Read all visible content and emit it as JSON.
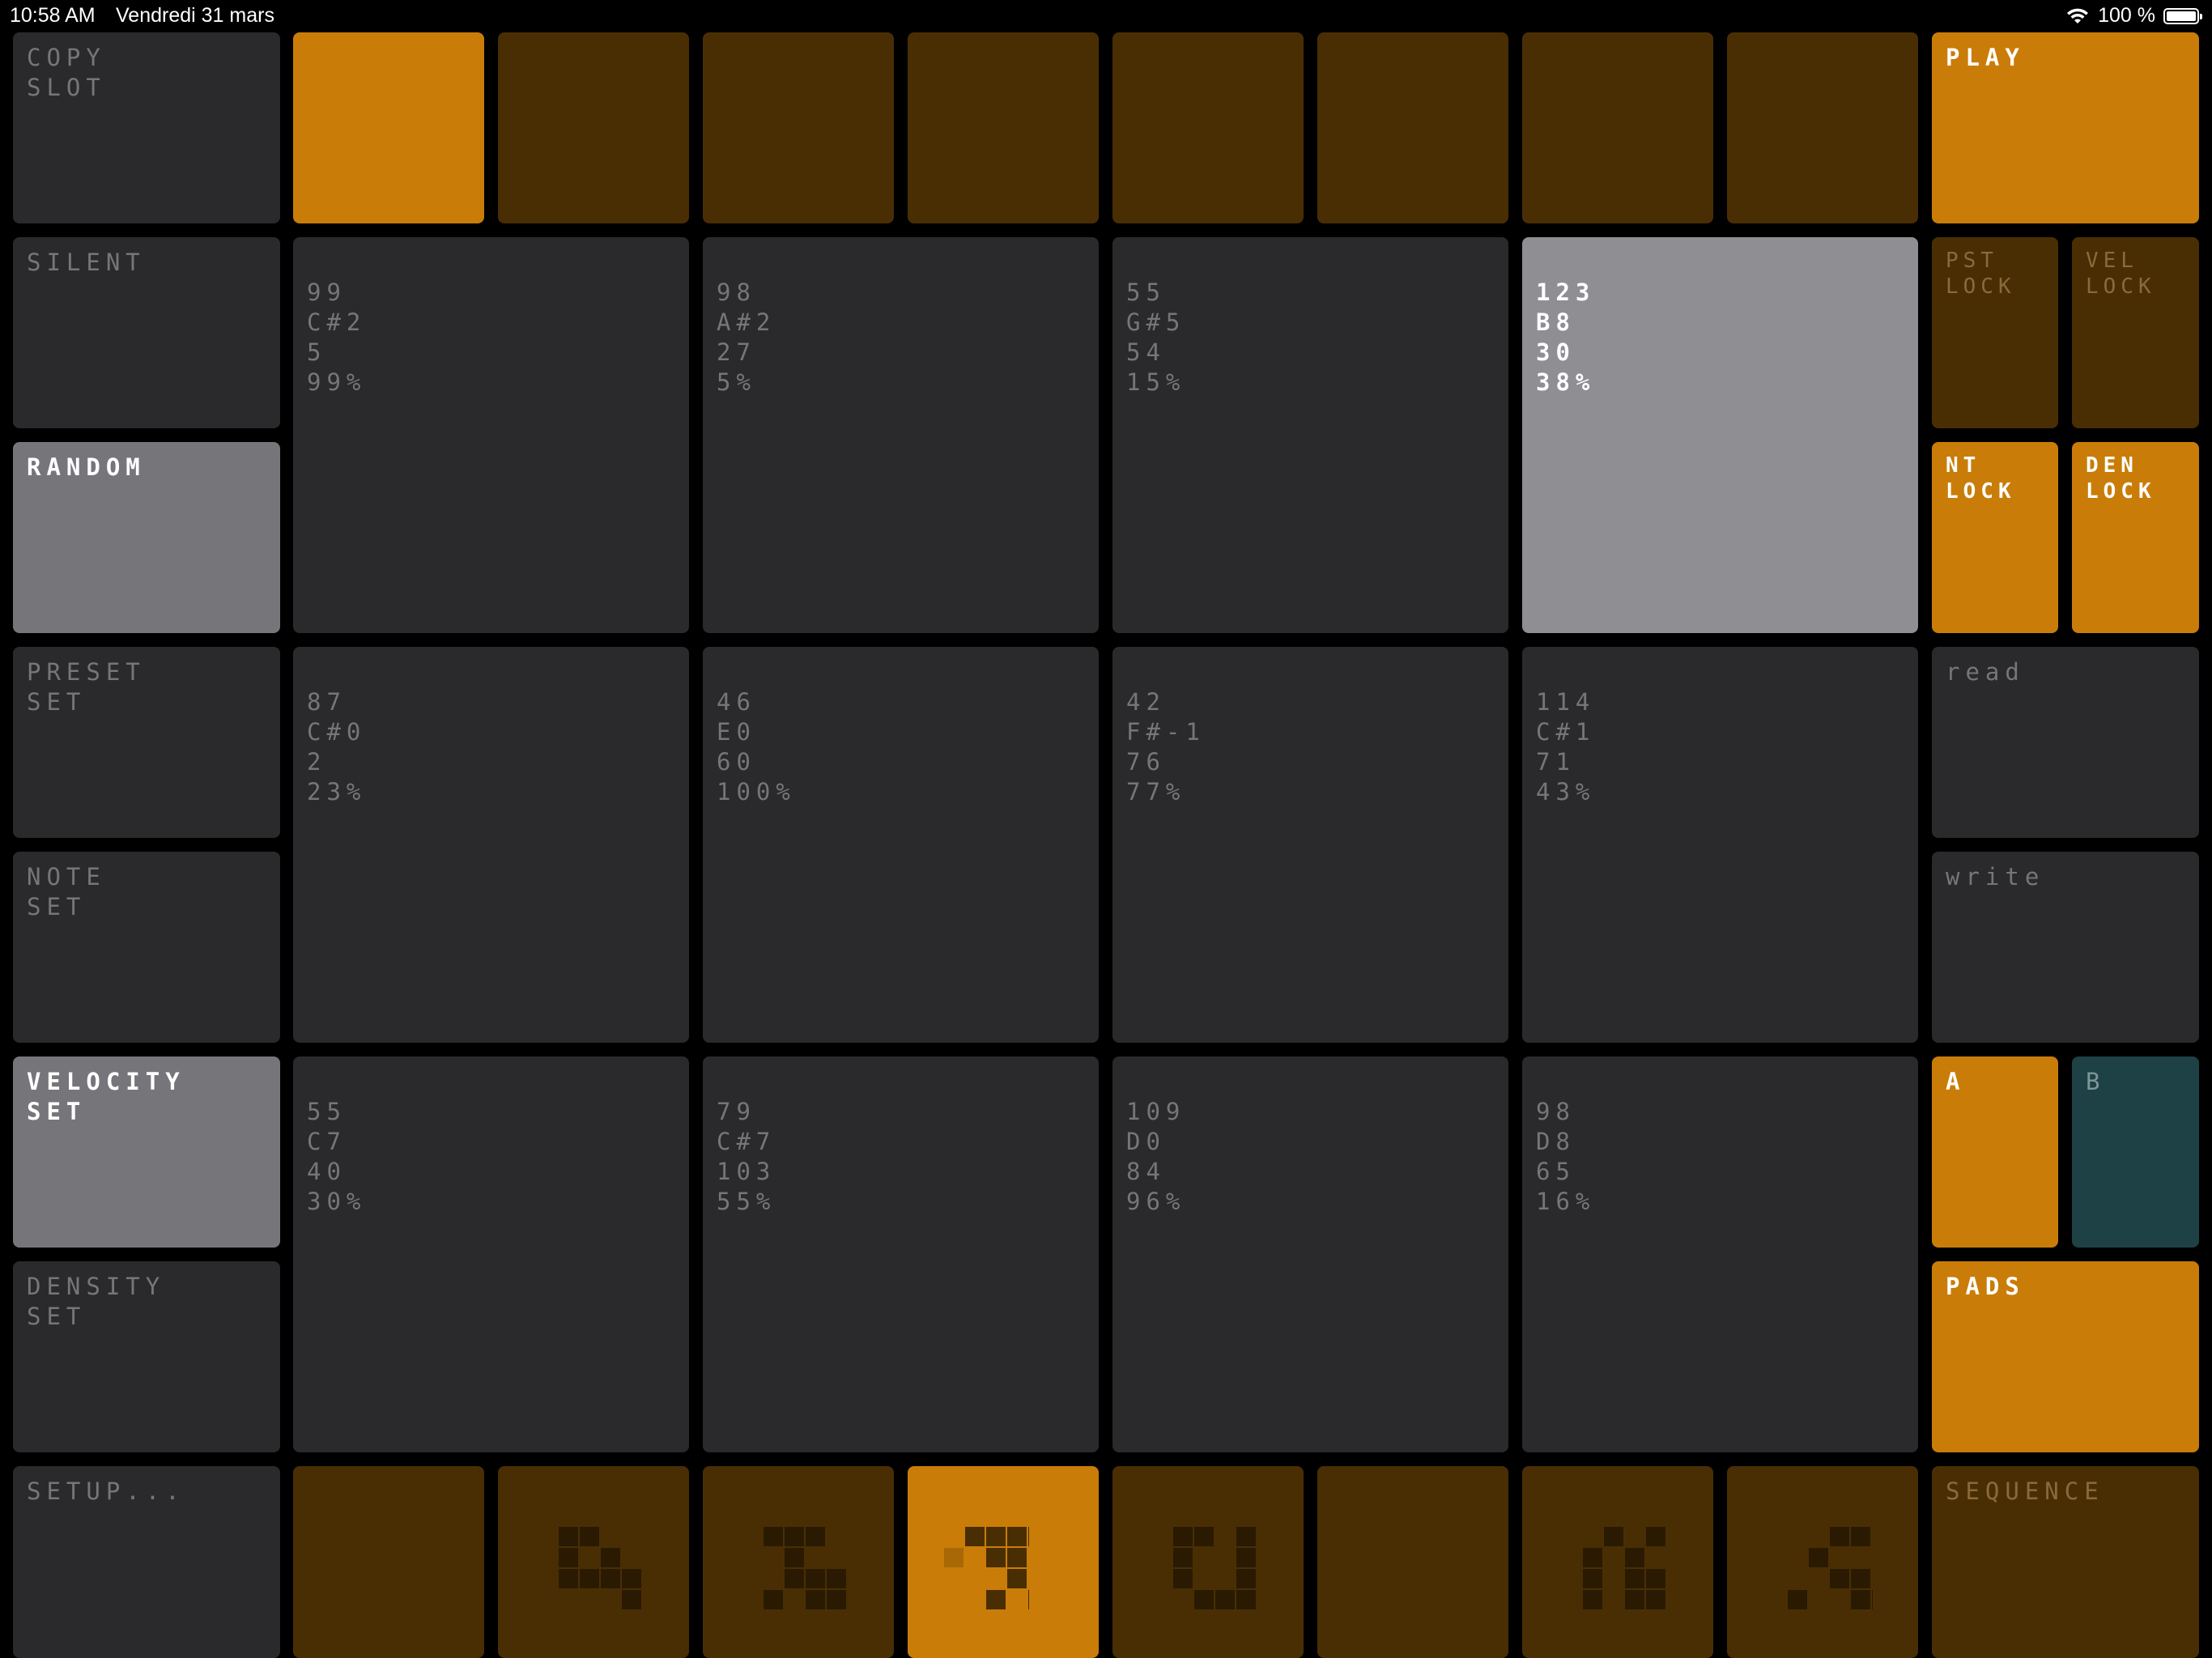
{
  "status": {
    "time": "10:58 AM",
    "date": "Vendredi 31 mars",
    "battery": "100 %"
  },
  "left": {
    "copy_slot": "COPY\nSLOT",
    "silent": "SILENT",
    "random": "RANDOM",
    "preset_set": "PRESET\nSET",
    "note_set": "NOTE\nSET",
    "velocity_set": "VELOCITY\nSET",
    "density_set": "DENSITY\nSET",
    "setup": "SETUP..."
  },
  "right": {
    "play": "PLAY",
    "pst_lock": "PST\nLOCK",
    "vel_lock": "VEL\nLOCK",
    "nt_lock": "NT\nLOCK",
    "den_lock": "DEN\nLOCK",
    "read": "read",
    "write": "write",
    "a": "A",
    "b": "B",
    "pads": "PADS",
    "sequence": "SEQUENCE"
  },
  "pads": [
    {
      "preset": "99",
      "note": "C#2",
      "velocity": "5",
      "density": "99%"
    },
    {
      "preset": "98",
      "note": "A#2",
      "velocity": "27",
      "density": "5%"
    },
    {
      "preset": "55",
      "note": "G#5",
      "velocity": "54",
      "density": "15%"
    },
    {
      "preset": "123",
      "note": "B8",
      "velocity": "30",
      "density": "38%"
    },
    {
      "preset": "87",
      "note": "C#0",
      "velocity": "2",
      "density": "23%"
    },
    {
      "preset": "46",
      "note": "E0",
      "velocity": "60",
      "density": "100%"
    },
    {
      "preset": "42",
      "note": "F#-1",
      "velocity": "76",
      "density": "77%"
    },
    {
      "preset": "114",
      "note": "C#1",
      "velocity": "71",
      "density": "43%"
    },
    {
      "preset": "55",
      "note": "C7",
      "velocity": "40",
      "density": "30%"
    },
    {
      "preset": "79",
      "note": "C#7",
      "velocity": "103",
      "density": "55%"
    },
    {
      "preset": "109",
      "note": "D0",
      "velocity": "84",
      "density": "96%"
    },
    {
      "preset": "98",
      "note": "D8",
      "velocity": "65",
      "density": "16%"
    }
  ],
  "colors": {
    "background": "#000000",
    "tile_dark": "#2a2a2c",
    "tile_grey": "#76767a",
    "tile_active": "#8e8e93",
    "accent_orange": "#c97d08",
    "brown": "#4a2e03",
    "teal": "#1d4144"
  }
}
